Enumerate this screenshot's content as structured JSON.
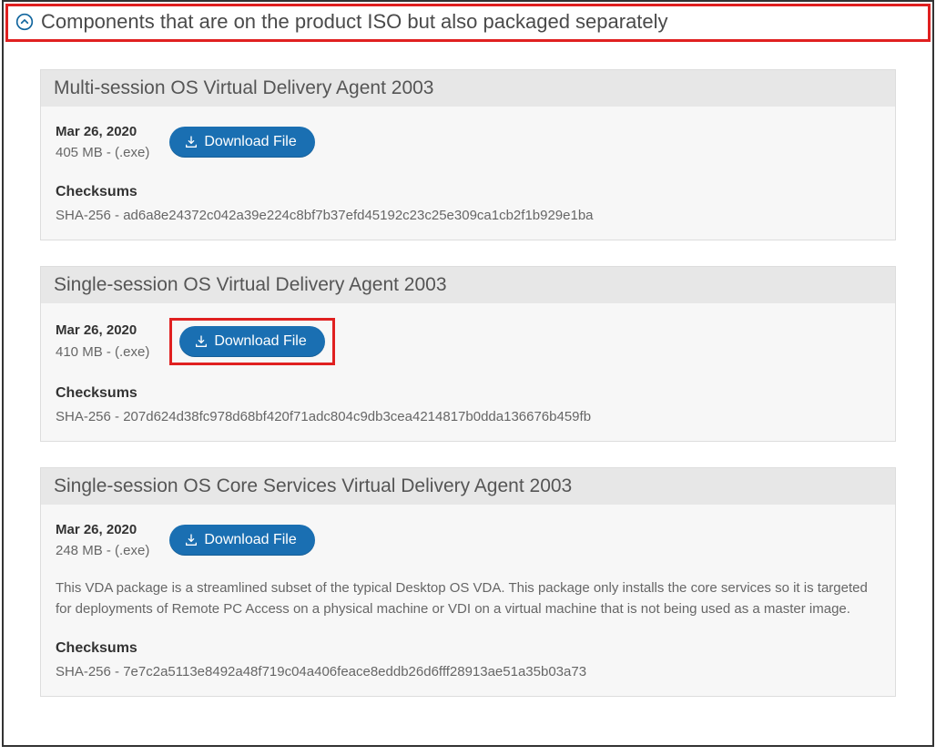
{
  "section_title": "Components that are on the product ISO but also packaged separately",
  "download_label": "Download File",
  "checksums_heading": "Checksums",
  "cards": [
    {
      "title": "Multi-session OS Virtual Delivery Agent 2003",
      "date": "Mar 26, 2020",
      "size": "405 MB - (.exe)",
      "description": "",
      "checksum": "SHA-256 - ad6a8e24372c042a39e224c8bf7b37efd45192c23c25e309ca1cb2f1b929e1ba",
      "highlighted": false
    },
    {
      "title": "Single-session OS Virtual Delivery Agent 2003",
      "date": "Mar 26, 2020",
      "size": "410 MB - (.exe)",
      "description": "",
      "checksum": "SHA-256 - 207d624d38fc978d68bf420f71adc804c9db3cea4214817b0dda136676b459fb",
      "highlighted": true
    },
    {
      "title": "Single-session OS Core Services Virtual Delivery Agent 2003",
      "date": "Mar 26, 2020",
      "size": "248 MB - (.exe)",
      "description": "This VDA package is a streamlined subset of the typical Desktop OS VDA. This package only installs the core services so it is targeted for deployments of Remote PC Access on a physical machine or VDI on a virtual machine that is not being used as a master image.",
      "checksum": "SHA-256 - 7e7c2a5113e8492a48f719c04a406feace8eddb26d6fff28913ae51a35b03a73",
      "highlighted": false
    }
  ]
}
